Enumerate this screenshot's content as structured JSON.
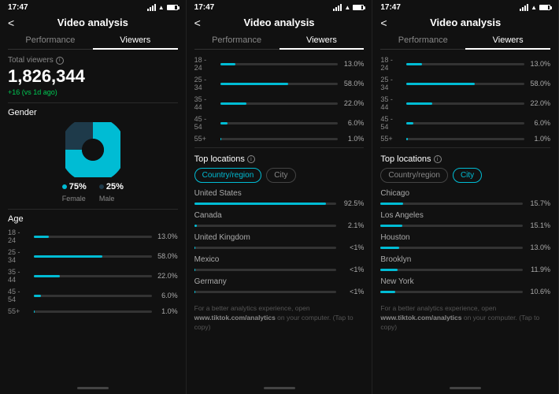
{
  "panels": [
    {
      "id": "panel1",
      "status": {
        "time": "17:47",
        "battery": 80
      },
      "header": {
        "back": "<",
        "title": "Video analysis"
      },
      "tabs": [
        {
          "id": "performance",
          "label": "Performance",
          "active": false
        },
        {
          "id": "viewers",
          "label": "Viewers",
          "active": true
        }
      ],
      "activeTab": "performance",
      "performance": {
        "totalViewers": {
          "label": "Total viewers",
          "value": "1,826,344",
          "change": "+16 (vs 1d ago)"
        },
        "gender": {
          "title": "Gender",
          "female": 75,
          "male": 25,
          "femaleLabel": "75%",
          "maleLabel": "25%",
          "femalePct": "Female",
          "malePct": "Male"
        },
        "age": {
          "title": "Age",
          "groups": [
            {
              "label": "18 - 24",
              "pct": 13,
              "display": "13.0%"
            },
            {
              "label": "25 - 34",
              "pct": 58,
              "display": "58.0%"
            },
            {
              "label": "35 - 44",
              "pct": 22,
              "display": "22.0%"
            },
            {
              "label": "45 - 54",
              "pct": 6,
              "display": "6.0%"
            },
            {
              "label": "55+",
              "pct": 1,
              "display": "1.0%"
            }
          ]
        }
      }
    },
    {
      "id": "panel2",
      "status": {
        "time": "17:47",
        "battery": 80
      },
      "header": {
        "back": "<",
        "title": "Video analysis"
      },
      "tabs": [
        {
          "id": "performance",
          "label": "Performance",
          "active": false
        },
        {
          "id": "viewers",
          "label": "Viewers",
          "active": true
        }
      ],
      "activeTab": "viewers",
      "viewers": {
        "ageGroups": [
          {
            "label": "18 - 24",
            "pct": 13,
            "display": "13.0%"
          },
          {
            "label": "25 - 34",
            "pct": 58,
            "display": "58.0%"
          },
          {
            "label": "35 - 44",
            "pct": 22,
            "display": "22.0%"
          },
          {
            "label": "45 - 54",
            "pct": 6,
            "display": "6.0%"
          },
          {
            "label": "55+",
            "pct": 1,
            "display": "1.0%"
          }
        ],
        "topLocations": {
          "title": "Top locations",
          "activeTab": "country",
          "tabs": [
            "Country/region",
            "City"
          ],
          "countries": [
            {
              "name": "United States",
              "pct": 92.5,
              "display": "92.5%"
            },
            {
              "name": "Canada",
              "pct": 2.1,
              "display": "2.1%"
            },
            {
              "name": "United Kingdom",
              "pct": 0.5,
              "display": "<1%"
            },
            {
              "name": "Mexico",
              "pct": 0.5,
              "display": "<1%"
            },
            {
              "name": "Germany",
              "pct": 0.5,
              "display": "<1%"
            }
          ]
        },
        "footer": "For a better analytics experience, open www.tiktok.com/analytics on your computer. (Tap to copy)"
      }
    },
    {
      "id": "panel3",
      "status": {
        "time": "17:47",
        "battery": 80
      },
      "header": {
        "back": "<",
        "title": "Video analysis"
      },
      "tabs": [
        {
          "id": "performance",
          "label": "Performance",
          "active": false
        },
        {
          "id": "viewers",
          "label": "Viewers",
          "active": true
        }
      ],
      "activeTab": "viewers",
      "viewers": {
        "ageGroups": [
          {
            "label": "18 - 24",
            "pct": 13,
            "display": "13.0%"
          },
          {
            "label": "25 - 34",
            "pct": 58,
            "display": "58.0%"
          },
          {
            "label": "35 - 44",
            "pct": 22,
            "display": "22.0%"
          },
          {
            "label": "45 - 54",
            "pct": 6,
            "display": "6.0%"
          },
          {
            "label": "55+",
            "pct": 1,
            "display": "1.0%"
          }
        ],
        "topLocations": {
          "title": "Top locations",
          "activeTab": "city",
          "tabs": [
            "Country/region",
            "City"
          ],
          "cities": [
            {
              "name": "Chicago",
              "pct": 15.7,
              "display": "15.7%"
            },
            {
              "name": "Los Angeles",
              "pct": 15.1,
              "display": "15.1%"
            },
            {
              "name": "Houston",
              "pct": 13.0,
              "display": "13.0%"
            },
            {
              "name": "Brooklyn",
              "pct": 11.9,
              "display": "11.9%"
            },
            {
              "name": "New York",
              "pct": 10.6,
              "display": "10.6%"
            }
          ]
        },
        "footer": "For a better analytics experience, open www.tiktok.com/analytics on your computer. (Tap to copy)"
      }
    }
  ],
  "colors": {
    "accent": "#00bcd4",
    "bg": "#111111",
    "text": "#ffffff",
    "subtext": "#888888",
    "positive": "#00c853"
  }
}
